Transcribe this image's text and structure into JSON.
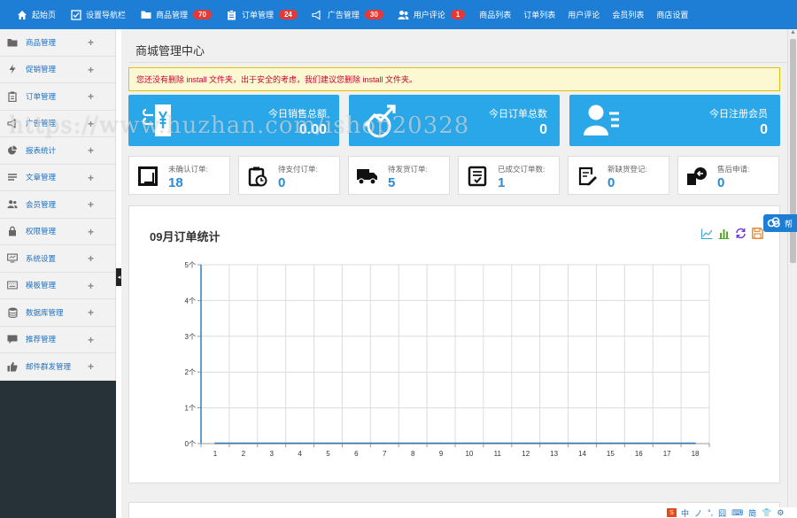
{
  "topnav": {
    "items": [
      {
        "label": "起始页",
        "icon": "home-icon"
      },
      {
        "label": "设置导航栏",
        "icon": "check-square-icon"
      },
      {
        "label": "商品管理",
        "icon": "folder-icon",
        "badge": "70"
      },
      {
        "label": "订单管理",
        "icon": "clipboard-icon",
        "badge": "24"
      },
      {
        "label": "广告管理",
        "icon": "megaphone-icon",
        "badge": "30"
      },
      {
        "label": "用户评论",
        "icon": "users-icon",
        "badge": "1"
      }
    ],
    "links": [
      "商品列表",
      "订单列表",
      "用户评论",
      "会员列表",
      "商店设置"
    ],
    "badge_color": "#e53935",
    "bg_color": "#1e7dd4"
  },
  "sidebar": {
    "items": [
      {
        "label": "商品管理",
        "icon": "folder-icon"
      },
      {
        "label": "促销管理",
        "icon": "lightning-icon"
      },
      {
        "label": "订单管理",
        "icon": "clipboard-icon"
      },
      {
        "label": "广告管理",
        "icon": "megaphone-icon"
      },
      {
        "label": "报表统计",
        "icon": "pie-chart-icon"
      },
      {
        "label": "文章管理",
        "icon": "list-icon"
      },
      {
        "label": "会员管理",
        "icon": "users-icon"
      },
      {
        "label": "权限管理",
        "icon": "lock-icon"
      },
      {
        "label": "系统设置",
        "icon": "monitor-icon"
      },
      {
        "label": "模板管理",
        "icon": "keyboard-icon"
      },
      {
        "label": "数据库管理",
        "icon": "database-icon"
      },
      {
        "label": "推荐管理",
        "icon": "comment-icon"
      },
      {
        "label": "邮件群发管理",
        "icon": "thumbs-up-icon"
      }
    ],
    "plus": "+",
    "collapse": "◂"
  },
  "main": {
    "title": "商城管理中心",
    "alert": "您还没有删除 install 文件夹，出于安全的考虑，我们建议您删除 install 文件夹。",
    "stats": [
      {
        "label": "今日销售总额",
        "value": "0.00",
        "icon": "yen-icon"
      },
      {
        "label": "今日订单总数",
        "value": "0",
        "icon": "trend-up-icon"
      },
      {
        "label": "今日注册会员",
        "value": "0",
        "icon": "user-list-icon"
      }
    ],
    "mini_stats": [
      {
        "label": "未确认订单:",
        "value": "18",
        "icon": "square-icon"
      },
      {
        "label": "待支付订单:",
        "value": "0",
        "icon": "clipboard-clock-icon"
      },
      {
        "label": "待发货订单:",
        "value": "5",
        "icon": "truck-icon"
      },
      {
        "label": "已成交订单数:",
        "value": "1",
        "icon": "doc-check-icon"
      },
      {
        "label": "新缺货登记:",
        "value": "0",
        "icon": "edit-doc-icon"
      },
      {
        "label": "售后申请:",
        "value": "0",
        "icon": "return-box-icon"
      }
    ],
    "chart_title": "09月订单统计",
    "chart_tools": [
      "line-chart-icon",
      "bar-chart-icon",
      "refresh-icon",
      "save-icon"
    ]
  },
  "float_button": {
    "label": "帮"
  },
  "watermark": "https://www.huzhan.com/ishop20328",
  "ime_bar": {
    "logo": "S",
    "items": [
      "中",
      "ノ",
      "°,",
      "囧",
      "⌨",
      "简",
      "👕",
      "⚙"
    ]
  },
  "chart_data": {
    "type": "line",
    "x": [
      1,
      2,
      3,
      4,
      5,
      6,
      7,
      8,
      9,
      10,
      11,
      12,
      13,
      14,
      15,
      16,
      17,
      18
    ],
    "y_ticks": [
      "0个",
      "1个",
      "2个",
      "3个",
      "4个",
      "5个"
    ],
    "ylim": [
      0,
      5
    ],
    "grid": true,
    "series": [
      {
        "values": [
          0,
          0,
          0,
          0,
          0,
          0,
          0,
          0,
          0,
          0,
          0,
          0,
          0,
          0,
          0,
          0,
          0,
          0
        ],
        "color": "#c9a07a"
      },
      {
        "values": [
          0,
          0,
          0,
          0,
          0,
          0,
          0,
          0,
          0,
          0,
          0,
          0,
          0,
          0,
          0,
          0,
          0,
          0
        ],
        "color": "#2e7fc7"
      }
    ]
  }
}
